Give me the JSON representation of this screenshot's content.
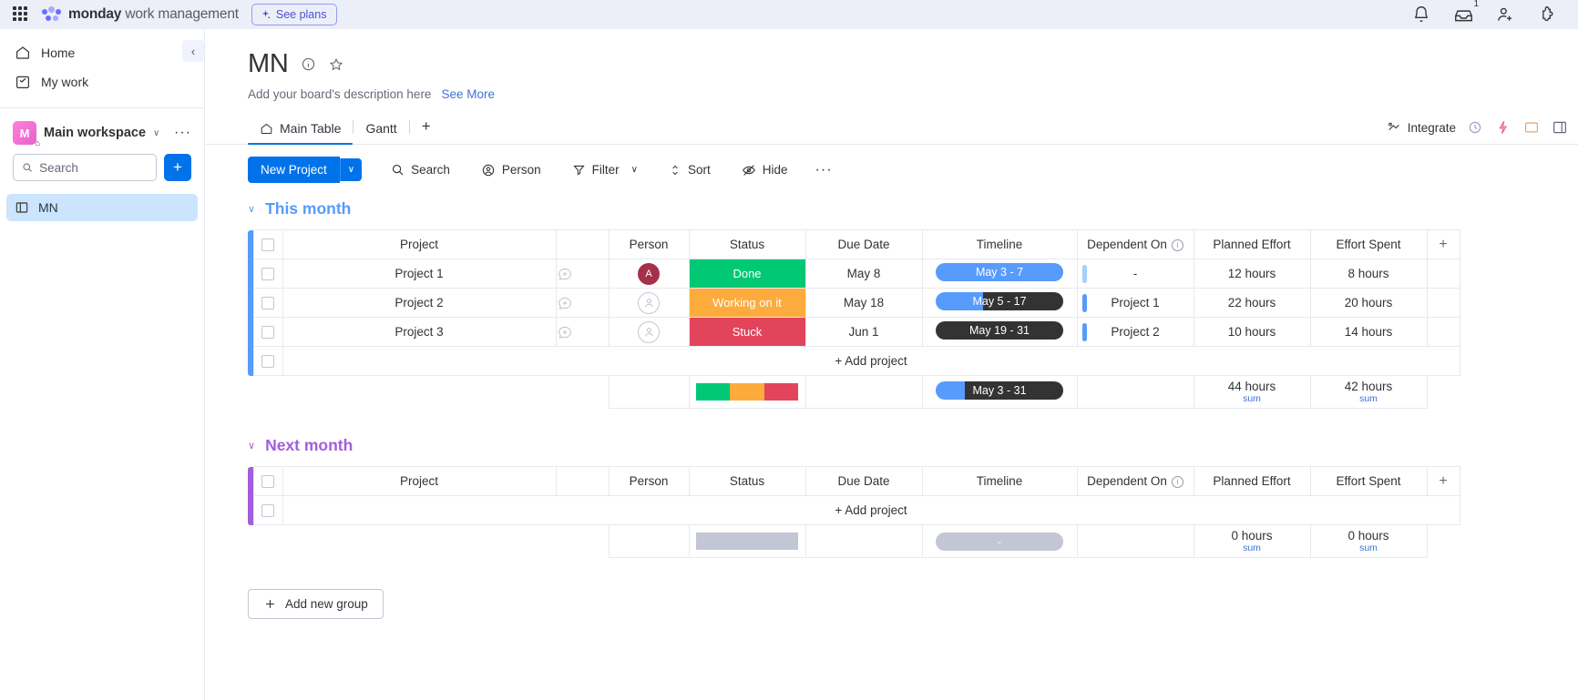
{
  "topbar": {
    "apps_grid": "apps-grid-icon",
    "brand_bold": "monday",
    "brand_light": " work management",
    "see_plans": "See plans",
    "icons": [
      {
        "name": "notifications-bell-icon",
        "badge": ""
      },
      {
        "name": "inbox-icon",
        "badge": "1"
      },
      {
        "name": "invite-member-icon",
        "badge": ""
      },
      {
        "name": "apps-marketplace-icon",
        "badge": ""
      }
    ]
  },
  "sidebar": {
    "links": [
      {
        "label": "Home",
        "icon": "home-icon"
      },
      {
        "label": "My work",
        "icon": "my-work-icon"
      }
    ],
    "workspace": {
      "initial": "M",
      "name": "Main workspace",
      "chevron": "∨",
      "menu_dots": "···"
    },
    "search_placeholder": "Search",
    "add_button": "+",
    "boards": [
      {
        "label": "MN",
        "icon": "board-icon",
        "selected": true
      }
    ],
    "collapse_icon": "‹"
  },
  "board": {
    "title": "MN",
    "info_icon": "info-icon",
    "favorite_icon": "star-icon",
    "description": "Add your board's description here",
    "see_more": "See More",
    "tabs": [
      {
        "label": "Main Table",
        "icon": "home-icon",
        "active": true
      },
      {
        "label": "Gantt",
        "icon": "",
        "active": false
      }
    ],
    "add_tab": "+",
    "integrate_label": "Integrate",
    "view_icons": [
      "automate-icon",
      "activity-icon",
      "board-power-ups-icon",
      "invite-icon",
      "board-menu-icon"
    ]
  },
  "toolbar": {
    "new_project": "New Project",
    "new_project_caret": "∨",
    "items": [
      {
        "label": "Search",
        "icon": "search-icon",
        "caret": false
      },
      {
        "label": "Person",
        "icon": "person-icon",
        "caret": false
      },
      {
        "label": "Filter",
        "icon": "filter-icon",
        "caret": true
      },
      {
        "label": "Sort",
        "icon": "sort-icon",
        "caret": false
      },
      {
        "label": "Hide",
        "icon": "hide-eye-icon",
        "caret": false
      }
    ],
    "more": "···"
  },
  "columns": [
    "Project",
    "Person",
    "Status",
    "Due Date",
    "Timeline",
    "Dependent On",
    "Planned Effort",
    "Effort Spent"
  ],
  "add_column": "+",
  "add_project_label": "+ Add project",
  "sum_label": "sum",
  "groups": [
    {
      "name": "This month",
      "color": "#579bfc",
      "caret": "∨",
      "rows": [
        {
          "project": "Project 1",
          "person": {
            "initial": "A",
            "color": "#a6304a",
            "empty": false
          },
          "status": {
            "label": "Done",
            "color": "#00c875"
          },
          "due_date": "May 8",
          "timeline": {
            "label": "May 3 - 7",
            "fill_pct": 100,
            "fill_color": "#579bfc",
            "rest_color": "#579bfc"
          },
          "dependent_on": "-",
          "dep_bar": "light",
          "planned_effort": "12 hours",
          "effort_spent": "8 hours"
        },
        {
          "project": "Project 2",
          "person": {
            "initial": "",
            "color": "",
            "empty": true
          },
          "status": {
            "label": "Working on it",
            "color": "#fdab3d"
          },
          "due_date": "May 18",
          "timeline": {
            "label": "May 5 - 17",
            "fill_pct": 37,
            "fill_color": "#579bfc",
            "rest_color": "#333333"
          },
          "dependent_on": "Project 1",
          "dep_bar": "solid",
          "planned_effort": "22 hours",
          "effort_spent": "20 hours"
        },
        {
          "project": "Project 3",
          "person": {
            "initial": "",
            "color": "",
            "empty": true
          },
          "status": {
            "label": "Stuck",
            "color": "#e2445c"
          },
          "due_date": "Jun 1",
          "timeline": {
            "label": "May 19 - 31",
            "fill_pct": 0,
            "fill_color": "#579bfc",
            "rest_color": "#333333"
          },
          "dependent_on": "Project 2",
          "dep_bar": "solid",
          "planned_effort": "10 hours",
          "effort_spent": "14 hours"
        }
      ],
      "summary": {
        "status_segments": [
          {
            "color": "#00c875",
            "pct": 33.4
          },
          {
            "color": "#fdab3d",
            "pct": 33.3
          },
          {
            "color": "#e2445c",
            "pct": 33.3
          }
        ],
        "timeline": {
          "label": "May 3 - 31",
          "fill_pct": 23,
          "fill_color": "#579bfc",
          "rest_color": "#333333"
        },
        "planned_effort": "44 hours",
        "effort_spent": "42 hours"
      }
    },
    {
      "name": "Next month",
      "color": "#a25ddc",
      "caret": "∨",
      "rows": [],
      "summary": {
        "status_segments": [
          {
            "color": "#c3c6d4",
            "pct": 100
          }
        ],
        "timeline": {
          "label": "-",
          "fill_pct": 0,
          "fill_color": "#c3c6d4",
          "rest_color": "#c3c6d4",
          "empty": true
        },
        "planned_effort": "0 hours",
        "effort_spent": "0 hours"
      }
    }
  ],
  "add_new_group": "Add new group"
}
